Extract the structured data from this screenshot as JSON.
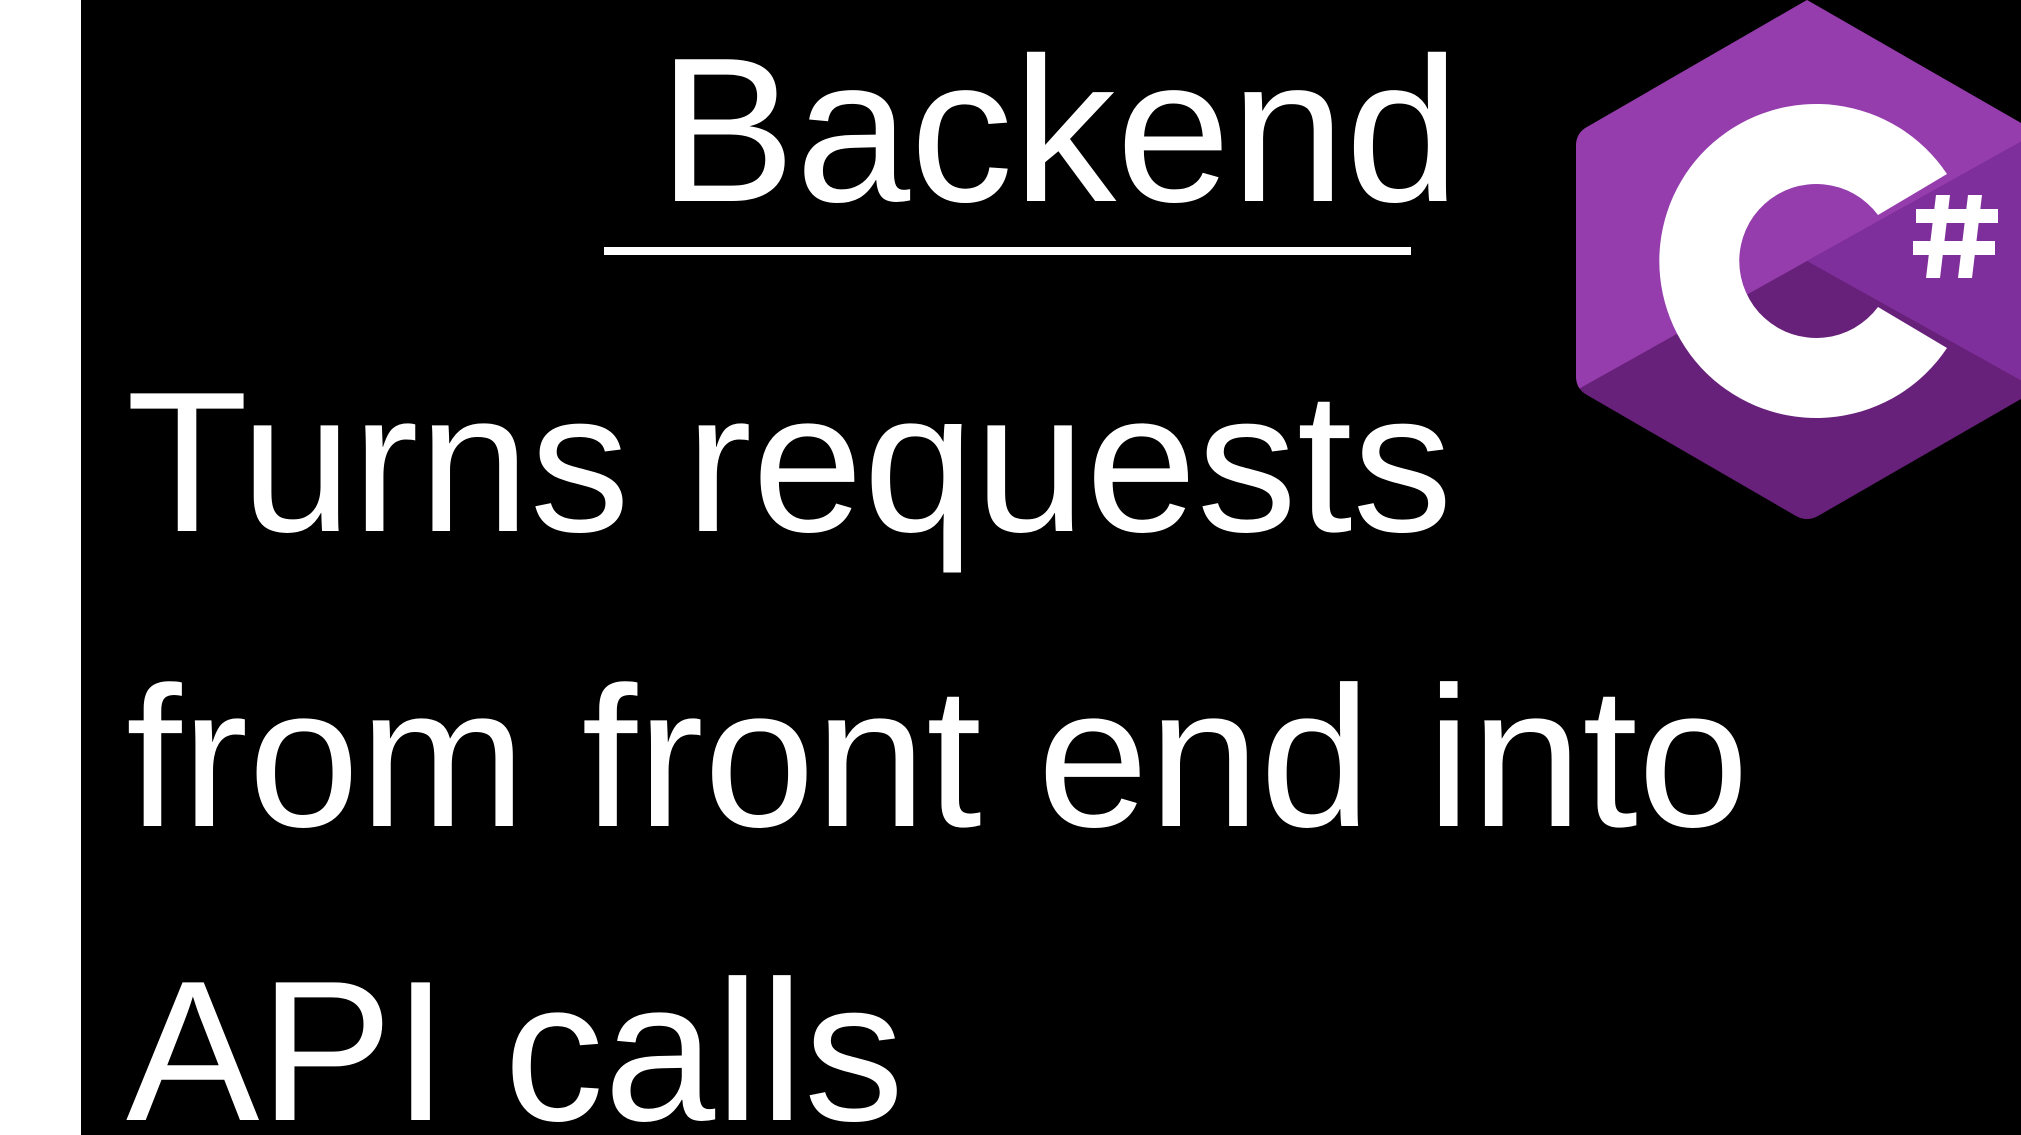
{
  "slide": {
    "title": "Backend",
    "body_lines": [
      "Turns requests",
      "from front end into",
      "API calls"
    ]
  },
  "logo": {
    "name": "csharp-logo-icon",
    "symbol": "C#",
    "colors": {
      "top": "#953DAC",
      "right": "#7F2F9B",
      "bottom": "#68217A",
      "letter": "#FFFFFF"
    }
  },
  "colors": {
    "background": "#000000",
    "text": "#FFFFFF",
    "page_margin": "#FFFFFF"
  }
}
